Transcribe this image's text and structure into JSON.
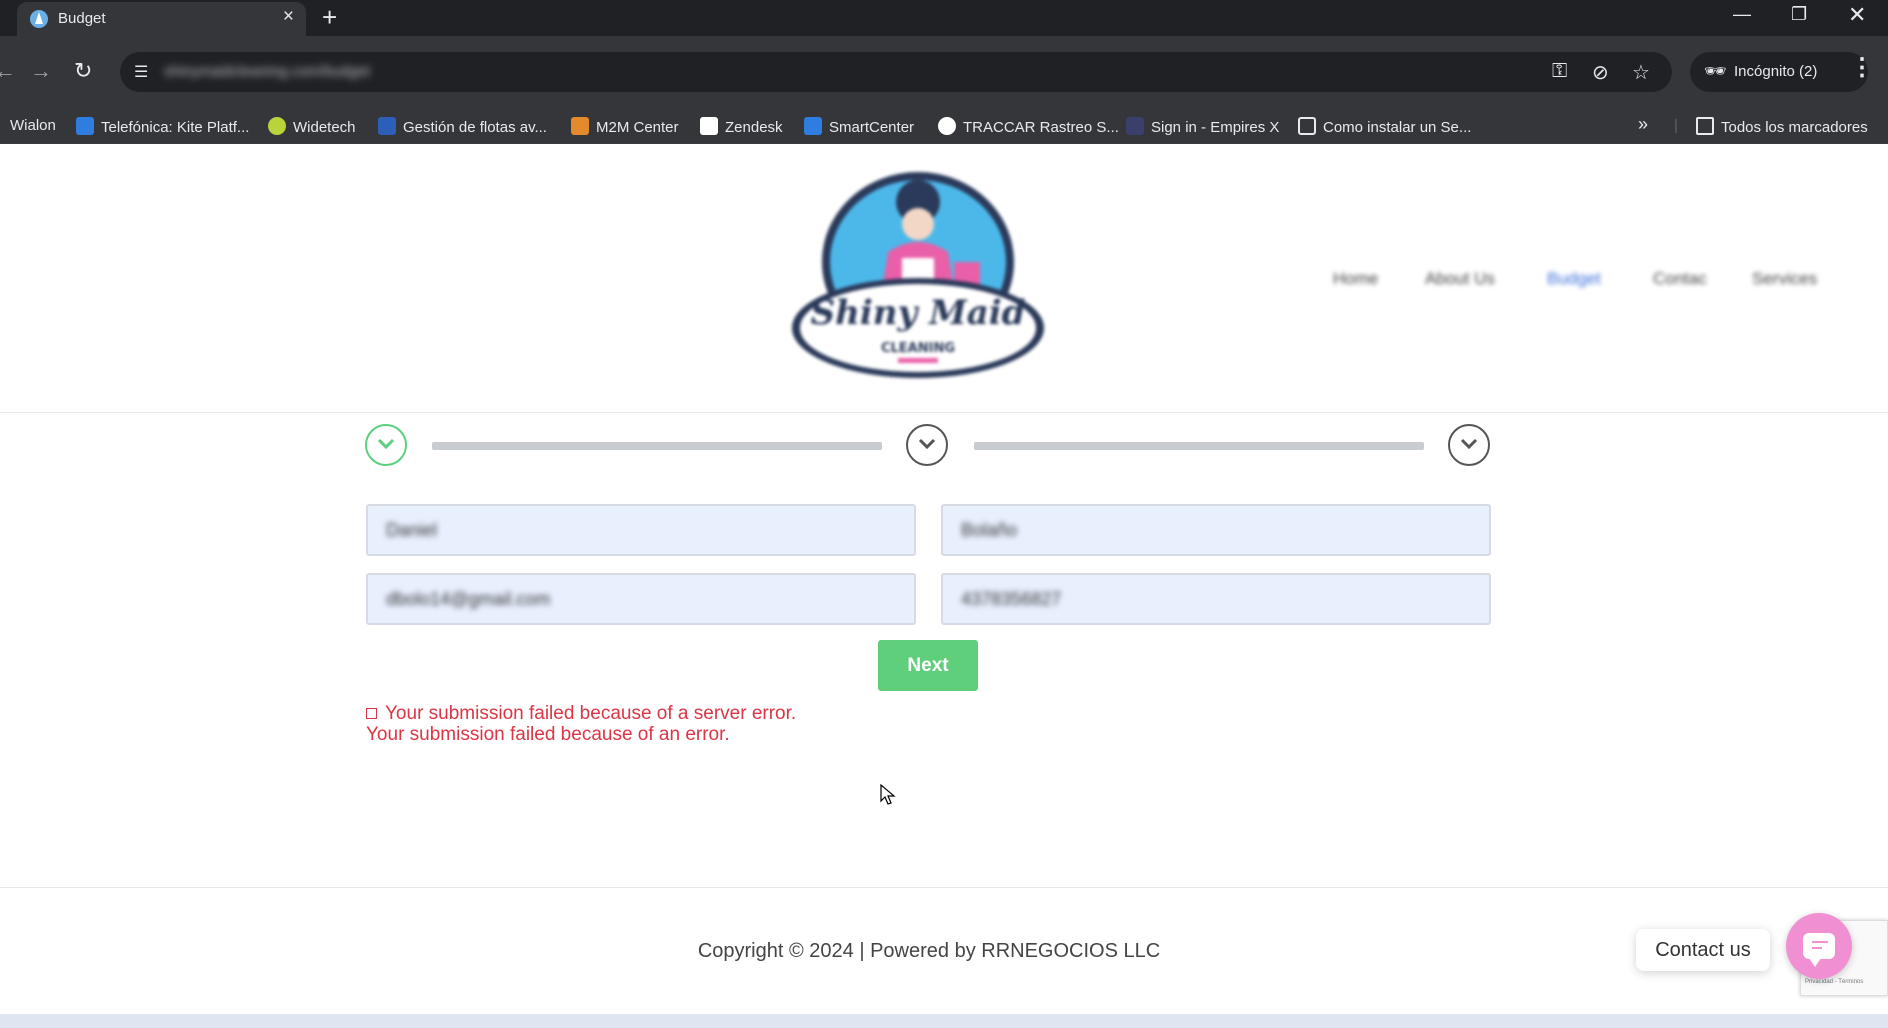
{
  "browser": {
    "tab_title": "Budget",
    "url": "shinymaidcleaning.com/budget",
    "incognito_label": "Incógnito (2)",
    "bookmarks": [
      {
        "label": "Wialon",
        "icon": "wialon-icon",
        "color": "#2b6fd6"
      },
      {
        "label": "Telefónica: Kite Platf...",
        "icon": "movistar-icon",
        "color": "#2f7de1"
      },
      {
        "label": "Widetech",
        "icon": "widetech-icon",
        "color": "#b8d43a"
      },
      {
        "label": "Gestión de flotas av...",
        "icon": "fleet-icon",
        "color": "#2d5fb8"
      },
      {
        "label": "M2M Center",
        "icon": "m2m-icon",
        "color": "#e38b2c"
      },
      {
        "label": "Zendesk",
        "icon": "zendesk-icon",
        "color": "#ffffff"
      },
      {
        "label": "SmartCenter",
        "icon": "movistar-icon",
        "color": "#2f7de1"
      },
      {
        "label": "TRACCAR Rastreo S...",
        "icon": "traccar-icon",
        "color": "#ffffff"
      },
      {
        "label": "Sign in - Empires X",
        "icon": "empires-icon",
        "color": "#3b3f6b"
      },
      {
        "label": "Como instalar un Se...",
        "icon": "share-icon",
        "color": "#ffffff"
      }
    ],
    "all_bookmarks_label": "Todos los marcadores"
  },
  "site": {
    "logo_text": "Shiny Maid",
    "logo_subtext": "CLEANING",
    "nav": [
      {
        "label": "Home",
        "active": false
      },
      {
        "label": "About Us",
        "active": false
      },
      {
        "label": "Budget",
        "active": true
      },
      {
        "label": "Contac",
        "active": false
      },
      {
        "label": "Services",
        "active": false
      }
    ]
  },
  "form": {
    "first_name": "Daniel",
    "last_name": "Bolaño",
    "email": "dbolo14@gmail.com",
    "phone": "4378356827",
    "next_label": "Next",
    "error_line1": "Your submission failed because of a server error.",
    "error_line2": "Your submission failed because of an error."
  },
  "footer": {
    "copyright": "Copyright © 2024 | Powered by RRNEGOCIOS LLC",
    "contact_label": "Contact us",
    "recaptcha_text": "Privacidad - Términos"
  },
  "colors": {
    "accent_green": "#5fcf7c",
    "error_red": "#dc3545",
    "chat_pink": "#f08fd1",
    "field_bg": "#e8f0fe"
  }
}
